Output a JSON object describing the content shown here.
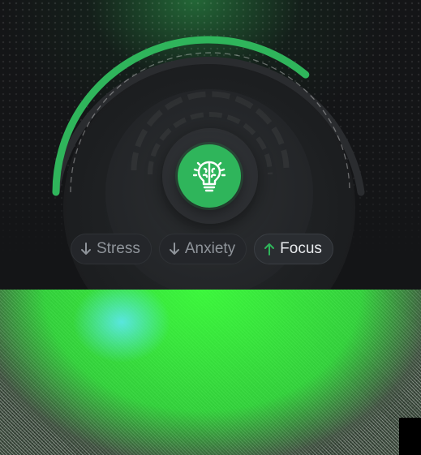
{
  "colors": {
    "accent": "#2fb55b",
    "track": "#2a2c2f",
    "background": "#141517",
    "chip_active_text": "#e9ebee",
    "chip_inactive_text": "#8f949a"
  },
  "gauge": {
    "level_fraction": 0.72
  },
  "center": {
    "icon": "brain-lightbulb-icon"
  },
  "chips": [
    {
      "label": "Stress",
      "direction": "down",
      "icon": "arrow-down-icon",
      "active": false
    },
    {
      "label": "Anxiety",
      "direction": "down",
      "icon": "arrow-down-icon",
      "active": false
    },
    {
      "label": "Focus",
      "direction": "up",
      "icon": "arrow-up-icon",
      "active": true
    }
  ]
}
